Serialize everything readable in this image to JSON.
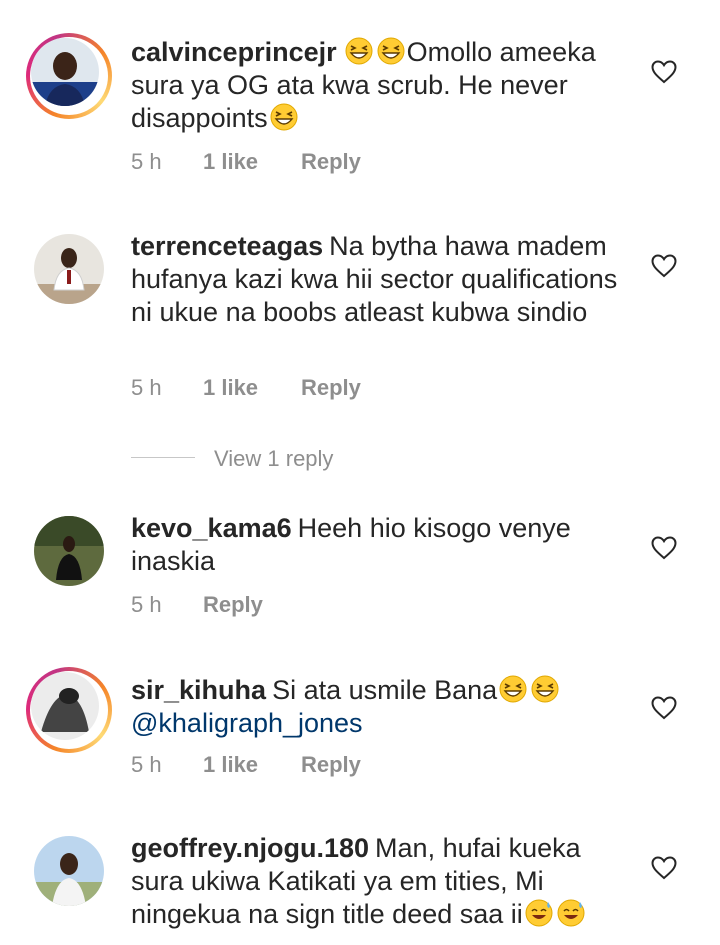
{
  "comments": [
    {
      "username": "calvinceprincejr",
      "pre_emojis": 2,
      "text": "Omollo ameeka sura ya OG ata kwa scrub. He never disappoints",
      "post_emojis": 1,
      "time": "5 h",
      "likes": "1 like",
      "reply": "Reply"
    },
    {
      "username": "terrenceteagas",
      "text": "Na bytha hawa madem hufanya kazi kwa hii sector qualifications ni ukue na boobs atleast kubwa sindio",
      "time": "5 h",
      "likes": "1 like",
      "reply": "Reply",
      "view_replies": "View 1 reply"
    },
    {
      "username": "kevo_kama6",
      "text": "Heeh hio kisogo venye inaskia",
      "time": "5 h",
      "reply": "Reply"
    },
    {
      "username": "sir_kihuha",
      "text": "Si ata usmile Bana",
      "post_emojis": 2,
      "mention": "@khaligraph_jones",
      "time": "5 h",
      "likes": "1 like",
      "reply": "Reply"
    },
    {
      "username": "geoffrey.njogu.180",
      "text": "Man, hufai kueka sura ukiwa Katikati ya em tities, Mi ningekua na sign title deed saa ii",
      "post_emojis": 2
    }
  ],
  "colors": {
    "text": "#262626",
    "meta": "#8e8e8e",
    "mention": "#00376b",
    "story_ring": "#dd2a7b"
  },
  "icons": {
    "like": "heart-outline-icon",
    "emoji_grin": "grinning-squinting-face",
    "emoji_smile": "smiling-face-with-sweat"
  }
}
